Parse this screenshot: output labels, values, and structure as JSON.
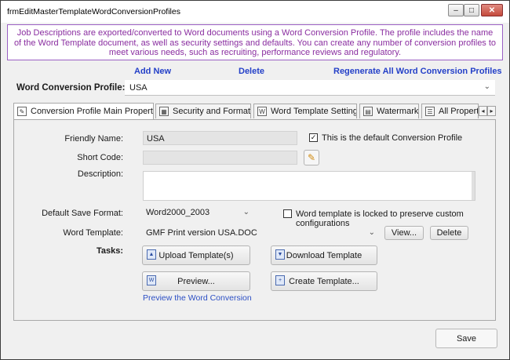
{
  "window": {
    "title": "frmEditMasterTemplateWordConversionProfiles",
    "min_glyph": "–",
    "max_glyph": "□",
    "close_glyph": "✕"
  },
  "banner": {
    "text": "Job Descriptions are exported/converted to Word documents using a Word Conversion Profile. The profile includes the name of the Word Template document, as well as security settings and defaults.  You can create any number of conversion profiles to meet various needs, such as recruiting, performance reviews and regulatory."
  },
  "actions": {
    "add_new": "Add New",
    "delete": "Delete",
    "regenerate": "Regenerate All Word Conversion Profiles"
  },
  "profile": {
    "label": "Word Conversion Profile:",
    "value": "USA"
  },
  "tabs": [
    {
      "label": "Conversion Profile Main Properties",
      "icon": "properties-icon"
    },
    {
      "label": "Security and Formats",
      "icon": "security-icon"
    },
    {
      "label": "Word Template Settings",
      "icon": "word-template-icon"
    },
    {
      "label": "Watermark",
      "icon": "watermark-icon"
    },
    {
      "label": "All Propert",
      "icon": "all-properties-icon"
    }
  ],
  "tab_nav": {
    "left": "◂",
    "right": "▸"
  },
  "form": {
    "friendly_name_label": "Friendly Name:",
    "friendly_name_value": "USA",
    "default_checkbox_label": "This is the default Conversion Profile",
    "default_checked": true,
    "short_code_label": "Short Code:",
    "short_code_value": "",
    "description_label": "Description:",
    "description_value": "",
    "default_save_format_label": "Default Save Format:",
    "default_save_format_value": "Word2000_2003",
    "locked_checkbox_label": "Word template is locked to preserve custom configurations",
    "locked_checked": false,
    "word_template_label": "Word Template:",
    "word_template_value": "GMF Print version USA.DOC",
    "view_button": "View...",
    "delete_button": "Delete",
    "tasks_label": "Tasks:",
    "upload_button": "Upload Template(s)",
    "download_button": "Download Template",
    "preview_button": "Preview...",
    "create_button": "Create Template...",
    "preview_link": "Preview the Word Conversion"
  },
  "footer": {
    "save_button": "Save"
  },
  "colors": {
    "banner_text": "#8a2ea0",
    "banner_border": "#9b60c4",
    "link_blue": "#2440c8"
  }
}
